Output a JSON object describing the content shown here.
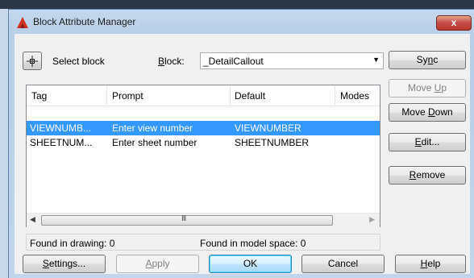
{
  "window": {
    "title": "Block Attribute Manager",
    "close_label": "x"
  },
  "toolbar": {
    "select_block_label": "Select block",
    "block_label": "Block:",
    "block_value": "_DetailCallout"
  },
  "table": {
    "headers": [
      "Tag",
      "Prompt",
      "Default",
      "Modes"
    ],
    "rows": [
      {
        "tag": "VIEWNUMB...",
        "prompt": "Enter view number",
        "default": "VIEWNUMBER",
        "modes": "",
        "selected": true
      },
      {
        "tag": "SHEETNUM...",
        "prompt": "Enter sheet number",
        "default": "SHEETNUMBER",
        "modes": "",
        "selected": false
      }
    ],
    "scroll_grip": "III"
  },
  "status": {
    "found_in_drawing": "Found in drawing: 0",
    "found_in_model_space": "Found in model space: 0"
  },
  "side_buttons": {
    "sync": {
      "pre": "Sy",
      "ul": "n",
      "post": "c"
    },
    "move_up": {
      "pre": "Move ",
      "ul": "U",
      "post": "p"
    },
    "move_down": {
      "pre": "Move ",
      "ul": "D",
      "post": "own"
    },
    "edit": {
      "pre": "",
      "ul": "E",
      "post": "dit..."
    },
    "remove": {
      "pre": "",
      "ul": "R",
      "post": "emove"
    }
  },
  "bottom_buttons": {
    "settings": {
      "pre": "",
      "ul": "S",
      "post": "ettings..."
    },
    "apply": {
      "pre": "",
      "ul": "A",
      "post": "pply"
    },
    "ok": "OK",
    "cancel": "Cancel",
    "help": {
      "pre": "",
      "ul": "H",
      "post": "elp"
    }
  },
  "colors": {
    "selection": "#3399ff",
    "titlebar": "#b9cfe7",
    "close": "#c75050"
  }
}
